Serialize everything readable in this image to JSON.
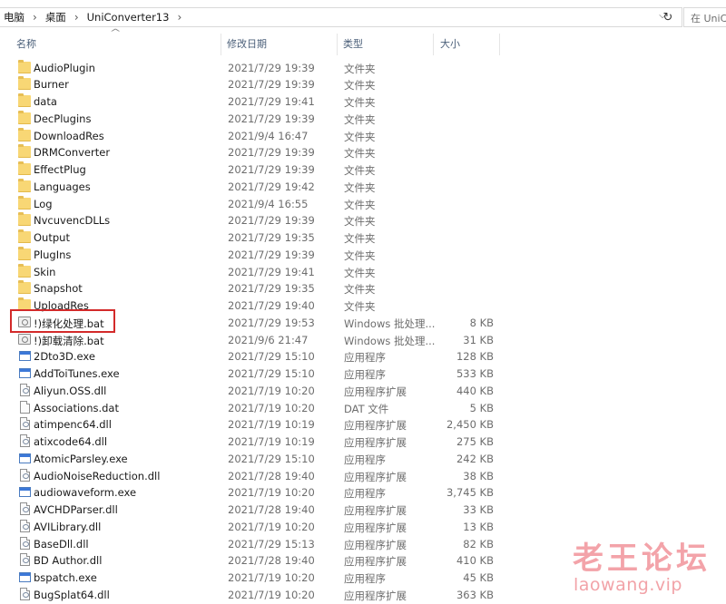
{
  "breadcrumb": [
    "电脑",
    "桌面",
    "UniConverter13"
  ],
  "search": {
    "placeholder": "在 UniCo"
  },
  "columns": {
    "name": "名称",
    "date": "修改日期",
    "type": "类型",
    "size": "大小"
  },
  "files": [
    {
      "name": "AudioPlugin",
      "date": "2021/7/29 19:39",
      "type": "文件夹",
      "size": "",
      "icon": "folder-icon"
    },
    {
      "name": "Burner",
      "date": "2021/7/29 19:39",
      "type": "文件夹",
      "size": "",
      "icon": "folder-icon"
    },
    {
      "name": "data",
      "date": "2021/7/29 19:41",
      "type": "文件夹",
      "size": "",
      "icon": "folder-icon"
    },
    {
      "name": "DecPlugins",
      "date": "2021/7/29 19:39",
      "type": "文件夹",
      "size": "",
      "icon": "folder-icon"
    },
    {
      "name": "DownloadRes",
      "date": "2021/9/4 16:47",
      "type": "文件夹",
      "size": "",
      "icon": "folder-icon"
    },
    {
      "name": "DRMConverter",
      "date": "2021/7/29 19:39",
      "type": "文件夹",
      "size": "",
      "icon": "folder-icon"
    },
    {
      "name": "EffectPlug",
      "date": "2021/7/29 19:39",
      "type": "文件夹",
      "size": "",
      "icon": "folder-icon"
    },
    {
      "name": "Languages",
      "date": "2021/7/29 19:42",
      "type": "文件夹",
      "size": "",
      "icon": "folder-icon"
    },
    {
      "name": "Log",
      "date": "2021/9/4 16:55",
      "type": "文件夹",
      "size": "",
      "icon": "folder-icon"
    },
    {
      "name": "NvcuvencDLLs",
      "date": "2021/7/29 19:39",
      "type": "文件夹",
      "size": "",
      "icon": "folder-icon"
    },
    {
      "name": "Output",
      "date": "2021/7/29 19:35",
      "type": "文件夹",
      "size": "",
      "icon": "folder-icon"
    },
    {
      "name": "PlugIns",
      "date": "2021/7/29 19:39",
      "type": "文件夹",
      "size": "",
      "icon": "folder-icon"
    },
    {
      "name": "Skin",
      "date": "2021/7/29 19:41",
      "type": "文件夹",
      "size": "",
      "icon": "folder-icon"
    },
    {
      "name": "Snapshot",
      "date": "2021/7/29 19:35",
      "type": "文件夹",
      "size": "",
      "icon": "folder-icon"
    },
    {
      "name": "UploadRes",
      "date": "2021/7/29 19:40",
      "type": "文件夹",
      "size": "",
      "icon": "folder-icon"
    },
    {
      "name": "!)绿化处理.bat",
      "date": "2021/7/29 19:53",
      "type": "Windows 批处理...",
      "size": "8 KB",
      "icon": "batch-file-icon"
    },
    {
      "name": "!)卸载清除.bat",
      "date": "2021/9/6 21:47",
      "type": "Windows 批处理...",
      "size": "31 KB",
      "icon": "batch-file-icon"
    },
    {
      "name": "2Dto3D.exe",
      "date": "2021/7/29 15:10",
      "type": "应用程序",
      "size": "128 KB",
      "icon": "exe-icon"
    },
    {
      "name": "AddToiTunes.exe",
      "date": "2021/7/29 15:10",
      "type": "应用程序",
      "size": "533 KB",
      "icon": "exe-icon"
    },
    {
      "name": "Aliyun.OSS.dll",
      "date": "2021/7/19 10:20",
      "type": "应用程序扩展",
      "size": "440 KB",
      "icon": "dll-icon"
    },
    {
      "name": "Associations.dat",
      "date": "2021/7/19 10:20",
      "type": "DAT 文件",
      "size": "5 KB",
      "icon": "file-icon"
    },
    {
      "name": "atimpenc64.dll",
      "date": "2021/7/19 10:19",
      "type": "应用程序扩展",
      "size": "2,450 KB",
      "icon": "dll-icon"
    },
    {
      "name": "atixcode64.dll",
      "date": "2021/7/19 10:19",
      "type": "应用程序扩展",
      "size": "275 KB",
      "icon": "dll-icon"
    },
    {
      "name": "AtomicParsley.exe",
      "date": "2021/7/29 15:10",
      "type": "应用程序",
      "size": "242 KB",
      "icon": "exe-icon"
    },
    {
      "name": "AudioNoiseReduction.dll",
      "date": "2021/7/28 19:40",
      "type": "应用程序扩展",
      "size": "38 KB",
      "icon": "dll-icon"
    },
    {
      "name": "audiowaveform.exe",
      "date": "2021/7/19 10:20",
      "type": "应用程序",
      "size": "3,745 KB",
      "icon": "exe-icon"
    },
    {
      "name": "AVCHDParser.dll",
      "date": "2021/7/28 19:40",
      "type": "应用程序扩展",
      "size": "33 KB",
      "icon": "dll-icon"
    },
    {
      "name": "AVILibrary.dll",
      "date": "2021/7/19 10:20",
      "type": "应用程序扩展",
      "size": "13 KB",
      "icon": "dll-icon"
    },
    {
      "name": "BaseDll.dll",
      "date": "2021/7/29 15:13",
      "type": "应用程序扩展",
      "size": "82 KB",
      "icon": "dll-icon"
    },
    {
      "name": "BD Author.dll",
      "date": "2021/7/28 19:40",
      "type": "应用程序扩展",
      "size": "410 KB",
      "icon": "dll-icon"
    },
    {
      "name": "bspatch.exe",
      "date": "2021/7/19 10:20",
      "type": "应用程序",
      "size": "45 KB",
      "icon": "exe-icon"
    },
    {
      "name": "BugSplat64.dll",
      "date": "2021/7/19 10:20",
      "type": "应用程序扩展",
      "size": "363 KB",
      "icon": "dll-icon"
    }
  ],
  "watermark": {
    "title": "老王论坛",
    "url": "laowang.vip"
  }
}
